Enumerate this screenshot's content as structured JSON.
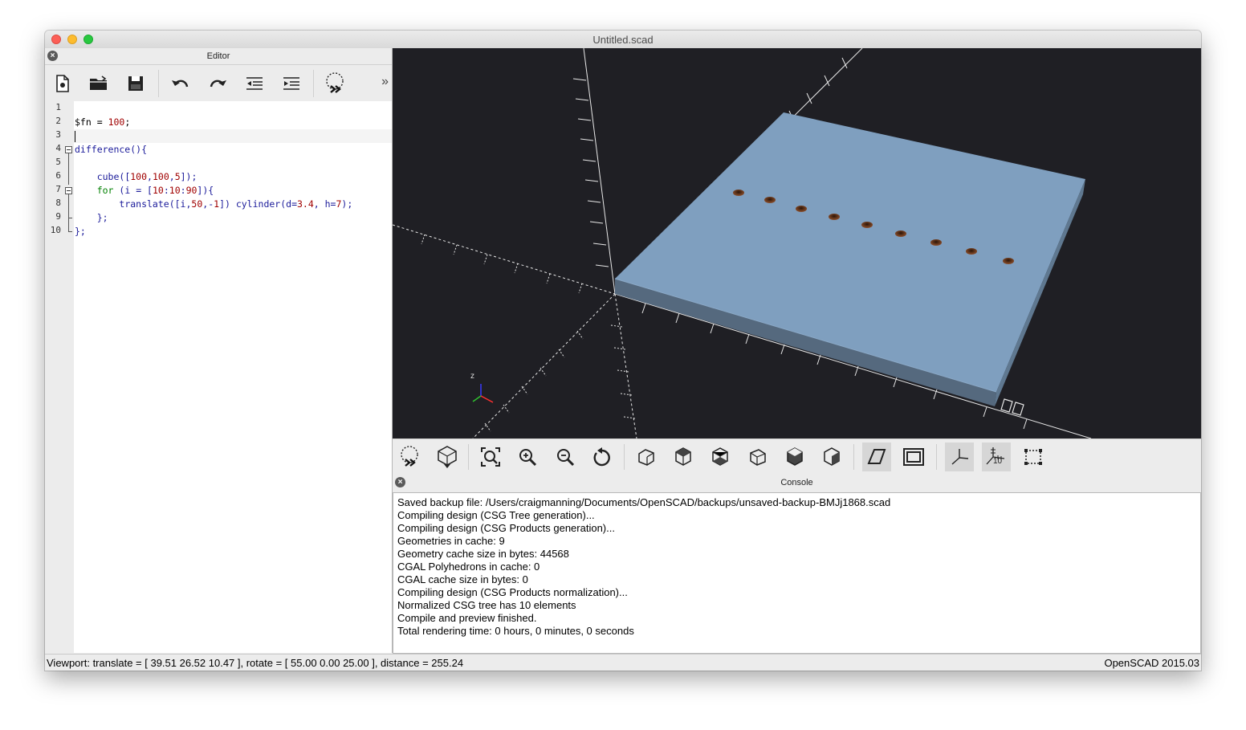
{
  "window": {
    "title": "Untitled.scad"
  },
  "editor": {
    "title": "Editor",
    "toolbar": {
      "buttons": [
        "new-file",
        "open-file",
        "save-file",
        "undo",
        "redo",
        "unindent",
        "indent",
        "preview"
      ],
      "more": "»"
    },
    "lines": [
      {
        "n": "1",
        "text": ""
      },
      {
        "n": "2",
        "text": "$fn = 100;"
      },
      {
        "n": "3",
        "text": ""
      },
      {
        "n": "4",
        "text": "difference(){"
      },
      {
        "n": "5",
        "text": ""
      },
      {
        "n": "6",
        "text": "    cube([100,100,5]);"
      },
      {
        "n": "7",
        "text": "    for (i = [10:10:90]){"
      },
      {
        "n": "8",
        "text": "        translate([i,50,-1]) cylinder(d=3.4, h=7);"
      },
      {
        "n": "9",
        "text": "    };"
      },
      {
        "n": "10",
        "text": "};"
      }
    ]
  },
  "view_toolbar": {
    "buttons": [
      "preview-icon",
      "render-icon",
      "view-all-icon",
      "zoom-in-icon",
      "zoom-out-icon",
      "reset-view-icon",
      "view-right-icon",
      "view-top-icon",
      "view-bottom-icon",
      "view-left-icon",
      "view-front-icon",
      "view-back-icon",
      "perspective-icon",
      "orthogonal-icon",
      "show-axes-icon",
      "show-scale-icon",
      "show-edges-icon"
    ],
    "scale_label": "10"
  },
  "axes_label": "z",
  "console": {
    "title": "Console",
    "lines": [
      "Saved backup file: /Users/craigmanning/Documents/OpenSCAD/backups/unsaved-backup-BMJj1868.scad",
      "Compiling design (CSG Tree generation)...",
      "Compiling design (CSG Products generation)...",
      "Geometries in cache: 9",
      "Geometry cache size in bytes: 44568",
      "CGAL Polyhedrons in cache: 0",
      "CGAL cache size in bytes: 0",
      "Compiling design (CSG Products normalization)...",
      "Normalized CSG tree has 10 elements",
      "Compile and preview finished.",
      "Total rendering time: 0 hours, 0 minutes, 0 seconds"
    ]
  },
  "status": {
    "viewport": "Viewport: translate = [ 39.51 26.52 10.47 ], rotate = [ 55.00 0.00 25.00 ], distance = 255.24",
    "version": "OpenSCAD 2015.03"
  },
  "colors": {
    "model": "#7f9fbf",
    "model_side": "#4f6478",
    "viewport_bg": "#1f1f24",
    "hole": "#5a3520"
  }
}
